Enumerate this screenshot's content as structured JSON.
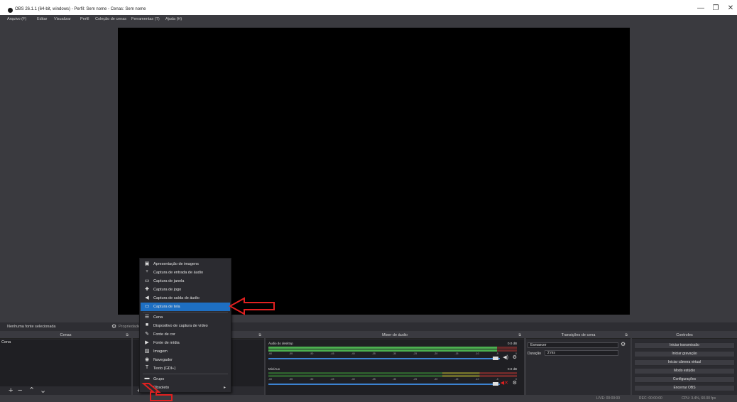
{
  "window": {
    "title": "OBS 26.1.1 (64-bit, windows) - Perfil: Sem nome - Cenas: Sem nome",
    "minimize": "—",
    "maximize": "❐",
    "close": "✕"
  },
  "menu": [
    "Arquivo (F)",
    "Editar",
    "Visualizar",
    "Perfil",
    "Coleção de cenas",
    "Ferramentas (T)",
    "Ajuda (H)"
  ],
  "source_bar": {
    "no_source": "Nenhuma fonte selecionada",
    "properties": "Propriedades"
  },
  "scenes": {
    "header": "Cenas",
    "items": [
      "Cena"
    ]
  },
  "sources": {
    "toolbar_plus": "+"
  },
  "mixer": {
    "header": "Mixer de áudio",
    "channels": [
      {
        "name": "Áudio do desktop",
        "db": "0.0 dB",
        "level": 0.92,
        "muted": false
      },
      {
        "name": "Mic/Aux",
        "db": "0.0 dB",
        "level": 0.0,
        "muted": true
      }
    ],
    "ticks": [
      "-60",
      "-55",
      "-50",
      "-45",
      "-40",
      "-35",
      "-30",
      "-25",
      "-20",
      "-15",
      "-10",
      "-5",
      "0"
    ]
  },
  "transitions": {
    "header": "Transições de cena",
    "selected": "Esmaecer",
    "duration_label": "Duração",
    "duration_value": "2 ms"
  },
  "controls": {
    "header": "Controles",
    "buttons": [
      "Iniciar transmissão",
      "Iniciar gravação",
      "Iniciar câmera virtual",
      "Modo estúdio",
      "Configurações",
      "Encerrar OBS"
    ]
  },
  "status": {
    "live": "LIVE: 00:00:00",
    "rec": "REC: 00:00:00",
    "cpu": "CPU: 3.4%, 60.00 fps"
  },
  "context_menu": {
    "items": [
      {
        "label": "Apresentação de imagens",
        "icon": "slideshow-icon",
        "glyph": "▣"
      },
      {
        "label": "Captura de entrada de áudio",
        "icon": "microphone-icon",
        "glyph": "♆"
      },
      {
        "label": "Captura de janela",
        "icon": "window-icon",
        "glyph": "▭"
      },
      {
        "label": "Captura de jogo",
        "icon": "gamepad-icon",
        "glyph": "✚"
      },
      {
        "label": "Captura de saída de áudio",
        "icon": "speaker-icon",
        "glyph": "◀"
      },
      {
        "label": "Captura de tela",
        "icon": "monitor-icon",
        "glyph": "▭",
        "selected": true
      },
      {
        "label": "Cena",
        "icon": "list-icon",
        "glyph": "☰"
      },
      {
        "label": "Dispositivo de captura de vídeo",
        "icon": "camera-icon",
        "glyph": "■"
      },
      {
        "label": "Fonte de cor",
        "icon": "brush-icon",
        "glyph": "✎"
      },
      {
        "label": "Fonte de mídia",
        "icon": "play-icon",
        "glyph": "▶"
      },
      {
        "label": "Imagem",
        "icon": "image-icon",
        "glyph": "▨"
      },
      {
        "label": "Navegador",
        "icon": "globe-icon",
        "glyph": "◉"
      },
      {
        "label": "Texto (GDI+)",
        "icon": "text-icon",
        "glyph": "T"
      },
      {
        "label": "Grupo",
        "icon": "folder-icon",
        "glyph": "▬"
      },
      {
        "label": "Obsoleto",
        "icon": "",
        "glyph": "",
        "submenu": "▸"
      }
    ]
  },
  "colors": {
    "highlight": "#1e6fc2",
    "arrow": "#e02020",
    "panel": "#2b2b30",
    "background": "#3a3a3f"
  }
}
